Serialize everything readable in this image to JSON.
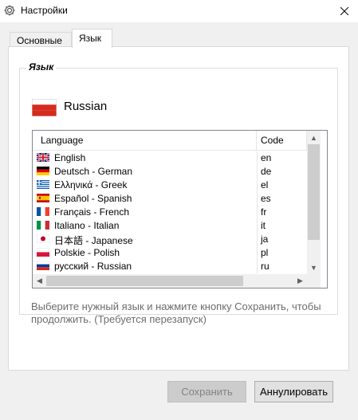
{
  "window": {
    "title": "Настройки",
    "icon": "gear-icon",
    "close_icon": "close-icon"
  },
  "tabs": [
    {
      "label": "Основные",
      "active": false
    },
    {
      "label": "Язык",
      "active": true
    }
  ],
  "language_group": {
    "title": "Язык",
    "current_language": "Russian",
    "current_flag": "flag-ru-icon"
  },
  "language_list": {
    "columns": {
      "language": "Language",
      "code": "Code"
    },
    "rows": [
      {
        "name": "English",
        "code": "en",
        "flag": "flag-gb-icon"
      },
      {
        "name": "Deutsch - German",
        "code": "de",
        "flag": "flag-de-icon"
      },
      {
        "name": "Ελληνικά - Greek",
        "code": "el",
        "flag": "flag-gr-icon"
      },
      {
        "name": "Español - Spanish",
        "code": "es",
        "flag": "flag-es-icon"
      },
      {
        "name": "Français - French",
        "code": "fr",
        "flag": "flag-fr-icon"
      },
      {
        "name": "Italiano - Italian",
        "code": "it",
        "flag": "flag-it-icon"
      },
      {
        "name": "日本語 - Japanese",
        "code": "ja",
        "flag": "flag-jp-icon"
      },
      {
        "name": "Polskie - Polish",
        "code": "pl",
        "flag": "flag-pl-icon"
      },
      {
        "name": "русский - Russian",
        "code": "ru",
        "flag": "flag-ru-icon"
      }
    ]
  },
  "hint": "Выберите нужный язык и нажмите кнопку Сохранить, чтобы продолжить. (Требуется перезапуск)",
  "buttons": {
    "save": {
      "label": "Сохранить",
      "enabled": false
    },
    "cancel": {
      "label": "Аннулировать",
      "enabled": true
    }
  },
  "colors": {
    "window_bg": "#f0f0f0",
    "panel_bg": "#ffffff",
    "disabled_text": "#838383",
    "hint_text": "#6d6d6d"
  }
}
